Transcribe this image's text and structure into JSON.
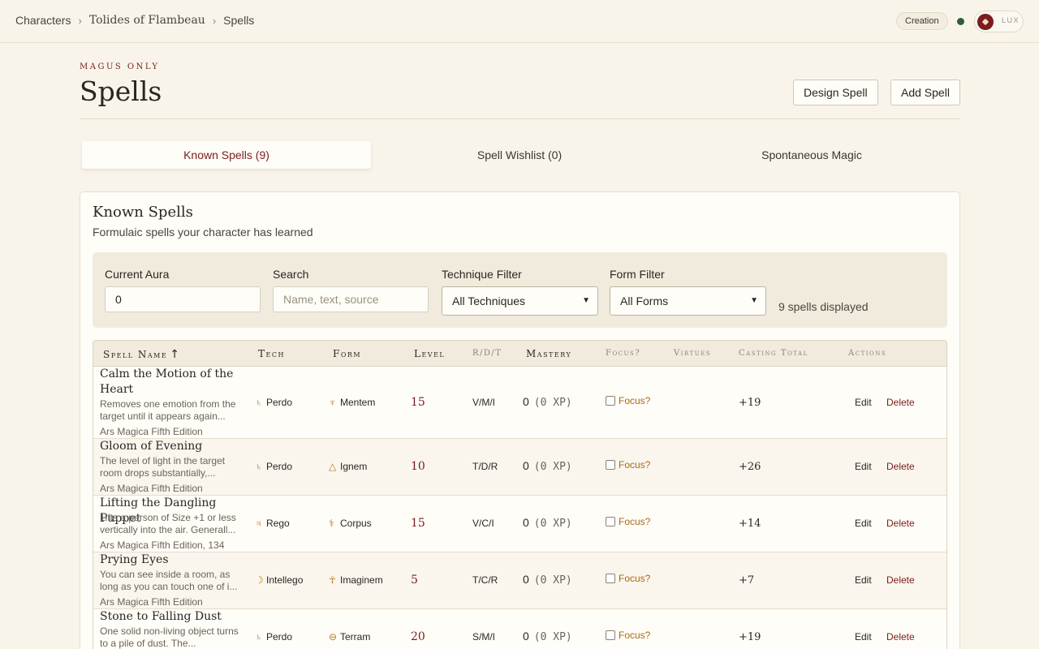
{
  "breadcrumb": {
    "items": [
      "Characters",
      "Tolides of Flambeau",
      "Spells"
    ],
    "separator": "›"
  },
  "topbar": {
    "mode_badge": "Creation",
    "theme_label": "LUX",
    "status_color": "#2f5d3a"
  },
  "header": {
    "overline": "MAGUS ONLY",
    "title": "Spells",
    "design_button": "Design Spell",
    "add_button": "Add Spell"
  },
  "tabs": [
    {
      "label": "Known Spells (9)",
      "active": true
    },
    {
      "label": "Spell Wishlist (0)",
      "active": false
    },
    {
      "label": "Spontaneous Magic",
      "active": false
    }
  ],
  "card": {
    "title": "Known Spells",
    "subtitle": "Formulaic spells your character has learned"
  },
  "filters": {
    "aura_label": "Current Aura",
    "aura_value": "0",
    "search_label": "Search",
    "search_placeholder": "Name, text, source",
    "technique_label": "Technique Filter",
    "technique_value": "All Techniques",
    "form_label": "Form Filter",
    "form_value": "All Forms",
    "count_text": "9 spells displayed"
  },
  "table": {
    "columns": {
      "name": "Spell Name",
      "sort_icon": "↑",
      "tech": "Tech",
      "form": "Form",
      "level": "Level",
      "rdt": "R/D/T",
      "mastery": "Mastery",
      "focus": "Focus?",
      "virtues": "Virtues",
      "casting": "Casting Total",
      "actions": "Actions"
    },
    "focus_label": "Focus?",
    "edit_label": "Edit",
    "delete_label": "Delete",
    "rows": [
      {
        "name": "Calm the Motion of the Heart",
        "desc": "Removes one emotion from the target until it appears again...",
        "source": "Ars Magica Fifth Edition",
        "tech": "Perdo",
        "tech_icon": "♄",
        "form": "Mentem",
        "form_icon": "♆",
        "level": "15",
        "rdt": "V/M/I",
        "mastery": "0",
        "xp": "(0 XP)",
        "total": "+19"
      },
      {
        "name": "Gloom of Evening",
        "desc": "The level of light in the target room drops substantially,...",
        "source": "Ars Magica Fifth Edition",
        "tech": "Perdo",
        "tech_icon": "♄",
        "form": "Ignem",
        "form_icon": "△",
        "level": "10",
        "rdt": "T/D/R",
        "mastery": "0",
        "xp": "(0 XP)",
        "total": "+26"
      },
      {
        "name": "Lifting the Dangling Puppet",
        "desc": "Lifts a person of Size +1 or less vertically into the air. Generall...",
        "source": "Ars Magica Fifth Edition, 134",
        "tech": "Rego",
        "tech_icon": "♃",
        "form": "Corpus",
        "form_icon": "⚕",
        "level": "15",
        "rdt": "V/C/I",
        "mastery": "0",
        "xp": "(0 XP)",
        "total": "+14"
      },
      {
        "name": "Prying Eyes",
        "desc": "You can see inside a room, as long as you can touch one of i...",
        "source": "Ars Magica Fifth Edition",
        "tech": "Intellego",
        "tech_icon": "☽",
        "form": "Imaginem",
        "form_icon": "☥",
        "level": "5",
        "rdt": "T/C/R",
        "mastery": "0",
        "xp": "(0 XP)",
        "total": "+7"
      },
      {
        "name": "Stone to Falling Dust",
        "desc": "One solid non-living object turns to a pile of dust. The...",
        "source": "",
        "tech": "Perdo",
        "tech_icon": "♄",
        "form": "Terram",
        "form_icon": "⊖",
        "level": "20",
        "rdt": "S/M/I",
        "mastery": "0",
        "xp": "(0 XP)",
        "total": "+19"
      }
    ]
  }
}
